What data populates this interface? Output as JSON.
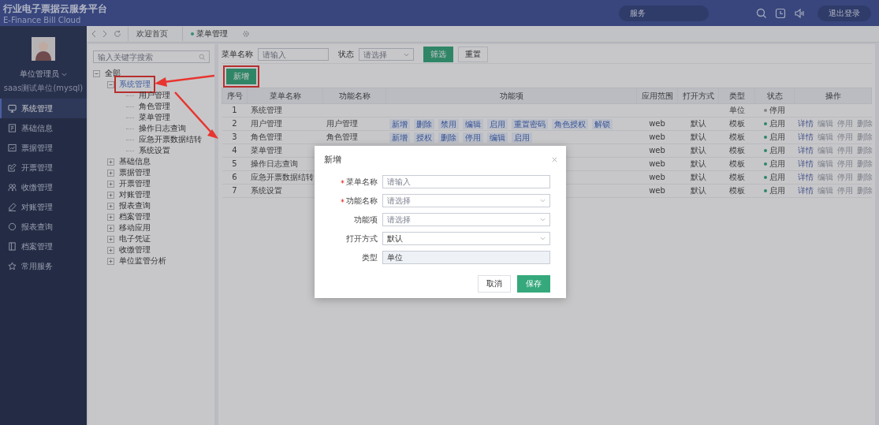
{
  "header": {
    "title": "行业电子票据云服务平台",
    "subtitle": "E-Finance Bill Cloud",
    "search_text": "服务",
    "logout": "退出登录"
  },
  "sidebar": {
    "user_name": "单位管理员",
    "org": "saas测试单位(mysql)",
    "menu": [
      {
        "label": "系统管理",
        "selected": true
      },
      {
        "label": "基础信息",
        "selected": false
      },
      {
        "label": "票据管理",
        "selected": false
      },
      {
        "label": "开票管理",
        "selected": false
      },
      {
        "label": "收缴管理",
        "selected": false
      },
      {
        "label": "对账管理",
        "selected": false
      },
      {
        "label": "报表查询",
        "selected": false
      },
      {
        "label": "档案管理",
        "selected": false
      },
      {
        "label": "常用服务",
        "selected": false
      }
    ]
  },
  "tabs": [
    {
      "label": "欢迎首页",
      "selected": false
    },
    {
      "label": "菜单管理",
      "selected": true
    }
  ],
  "tree": {
    "search_placeholder": "输入关键字搜索",
    "nodes": [
      {
        "label": "全部",
        "expanded": true,
        "selected": false,
        "highlighted": false,
        "children": [
          {
            "label": "系统管理",
            "expanded": true,
            "selected": true,
            "highlighted": true,
            "children": [
              {
                "label": "用户管理",
                "selected": false,
                "highlighted": false
              },
              {
                "label": "角色管理",
                "selected": false,
                "highlighted": false
              },
              {
                "label": "菜单管理",
                "selected": false,
                "highlighted": false
              },
              {
                "label": "操作日志查询",
                "selected": false,
                "highlighted": false
              },
              {
                "label": "应急开票数据结转",
                "selected": false,
                "highlighted": false
              },
              {
                "label": "系统设置",
                "selected": false,
                "highlighted": false
              }
            ]
          },
          {
            "label": "基础信息",
            "expanded": false,
            "selected": false,
            "highlighted": false
          },
          {
            "label": "票据管理",
            "expanded": false,
            "selected": false,
            "highlighted": false
          },
          {
            "label": "开票管理",
            "expanded": false,
            "selected": false,
            "highlighted": false
          },
          {
            "label": "对账管理",
            "expanded": false,
            "selected": false,
            "highlighted": false
          },
          {
            "label": "报表查询",
            "expanded": false,
            "selected": false,
            "highlighted": false
          },
          {
            "label": "档案管理",
            "expanded": false,
            "selected": false,
            "highlighted": false
          },
          {
            "label": "移动应用",
            "expanded": false,
            "selected": false,
            "highlighted": false
          },
          {
            "label": "电子凭证",
            "expanded": false,
            "selected": false,
            "highlighted": false
          },
          {
            "label": "收缴管理",
            "expanded": false,
            "selected": false,
            "highlighted": false
          },
          {
            "label": "单位监管分析",
            "expanded": false,
            "selected": false,
            "highlighted": false
          }
        ]
      }
    ]
  },
  "filter": {
    "fields": [
      {
        "kind": "input",
        "label": "菜单名称",
        "placeholder": "请输入"
      },
      {
        "kind": "select",
        "label": "状态",
        "placeholder": "请选择"
      }
    ],
    "buttons": [
      {
        "kind": "primary",
        "label": "筛选"
      },
      {
        "kind": "default",
        "label": "重置"
      }
    ]
  },
  "add_button": {
    "label": "新增",
    "highlighted": true
  },
  "table": {
    "columns": [
      "序号",
      "菜单名称",
      "功能名称",
      "功能项",
      "应用范围",
      "打开方式",
      "类型",
      "状态",
      "操作"
    ],
    "rows": [
      {
        "no": "1",
        "menu_name": "系统管理",
        "type": "单位",
        "status": {
          "label": "停用",
          "enabled": false
        }
      },
      {
        "no": "2",
        "menu_name": "用户管理",
        "function_name": "用户管理",
        "items": [
          "新增",
          "删除",
          "禁用",
          "编辑",
          "启用",
          "重置密码",
          "角色授权",
          "解锁"
        ],
        "scope": "web",
        "open_mode": "默认",
        "type": "模板",
        "status": {
          "label": "启用",
          "enabled": true
        },
        "actions": [
          {
            "label": "详情",
            "disabled": false
          },
          {
            "label": "编辑",
            "disabled": true
          },
          {
            "label": "停用",
            "disabled": true
          },
          {
            "label": "删除",
            "disabled": true
          }
        ]
      },
      {
        "no": "3",
        "menu_name": "角色管理",
        "function_name": "角色管理",
        "items": [
          "新增",
          "授权",
          "删除",
          "停用",
          "编辑",
          "启用"
        ],
        "scope": "web",
        "open_mode": "默认",
        "type": "模板",
        "status": {
          "label": "启用",
          "enabled": true
        },
        "actions": [
          {
            "label": "详情",
            "disabled": false
          },
          {
            "label": "编辑",
            "disabled": true
          },
          {
            "label": "停用",
            "disabled": true
          },
          {
            "label": "删除",
            "disabled": true
          }
        ]
      },
      {
        "no": "4",
        "menu_name": "菜单管理",
        "scope": "web",
        "open_mode": "默认",
        "type": "模板",
        "status": {
          "label": "启用",
          "enabled": true
        },
        "actions": [
          {
            "label": "详情",
            "disabled": false
          },
          {
            "label": "编辑",
            "disabled": true
          },
          {
            "label": "停用",
            "disabled": true
          },
          {
            "label": "删除",
            "disabled": true
          }
        ]
      },
      {
        "no": "5",
        "menu_name": "操作日志查询",
        "scope": "web",
        "open_mode": "默认",
        "type": "模板",
        "status": {
          "label": "启用",
          "enabled": true
        },
        "actions": [
          {
            "label": "详情",
            "disabled": false
          },
          {
            "label": "编辑",
            "disabled": true
          },
          {
            "label": "停用",
            "disabled": true
          },
          {
            "label": "删除",
            "disabled": true
          }
        ]
      },
      {
        "no": "6",
        "menu_name": "应急开票数据结转",
        "scope": "web",
        "open_mode": "默认",
        "type": "模板",
        "status": {
          "label": "启用",
          "enabled": true
        },
        "actions": [
          {
            "label": "详情",
            "disabled": false
          },
          {
            "label": "编辑",
            "disabled": true
          },
          {
            "label": "停用",
            "disabled": true
          },
          {
            "label": "删除",
            "disabled": true
          }
        ]
      },
      {
        "no": "7",
        "menu_name": "系统设置",
        "scope": "web",
        "open_mode": "默认",
        "type": "模板",
        "status": {
          "label": "启用",
          "enabled": true
        },
        "actions": [
          {
            "label": "详情",
            "disabled": false
          },
          {
            "label": "编辑",
            "disabled": true
          },
          {
            "label": "停用",
            "disabled": true
          },
          {
            "label": "删除",
            "disabled": true
          }
        ]
      }
    ]
  },
  "modal": {
    "title": "新增",
    "fields": [
      {
        "kind": "input",
        "label": "菜单名称",
        "required": true,
        "placeholder": "请输入"
      },
      {
        "kind": "select",
        "label": "功能名称",
        "required": true,
        "placeholder": "请选择"
      },
      {
        "kind": "select",
        "label": "功能项",
        "required": false,
        "placeholder": "请选择"
      },
      {
        "kind": "select",
        "label": "打开方式",
        "required": false,
        "value": "默认"
      },
      {
        "kind": "readonly",
        "label": "类型",
        "required": false,
        "value": "单位"
      }
    ],
    "buttons": [
      {
        "kind": "default",
        "label": "取消"
      },
      {
        "kind": "primary",
        "label": "保存"
      }
    ]
  }
}
